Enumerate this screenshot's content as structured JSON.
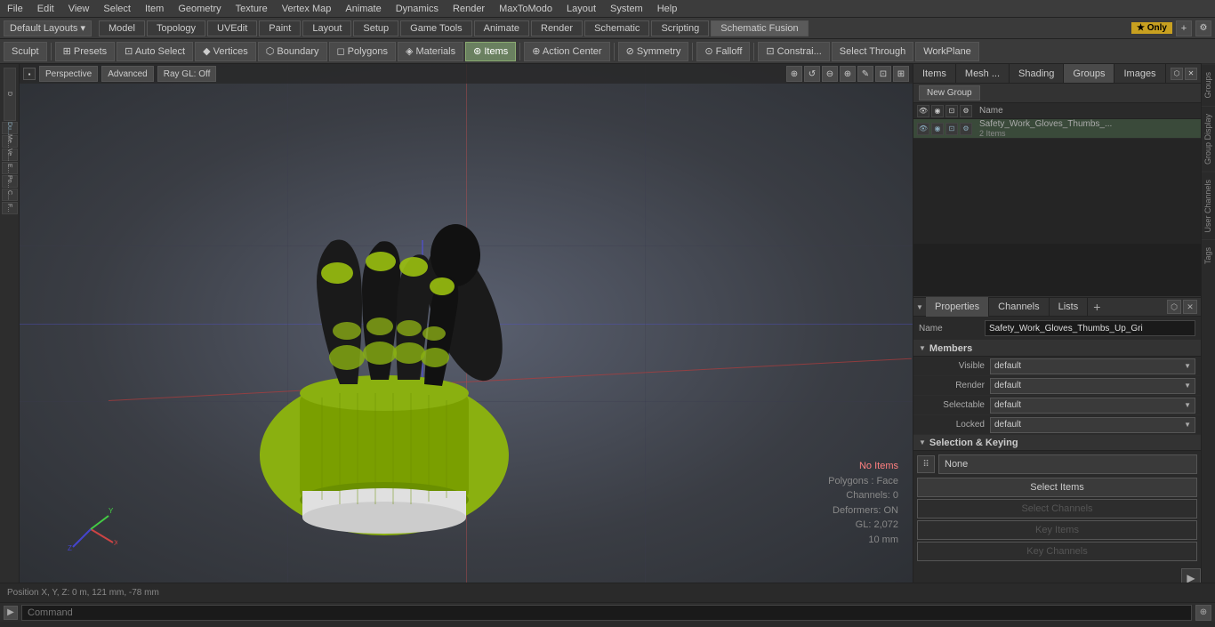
{
  "menubar": {
    "items": [
      "File",
      "Edit",
      "View",
      "Select",
      "Item",
      "Geometry",
      "Texture",
      "Vertex Map",
      "Animate",
      "Dynamics",
      "Render",
      "MaxToModo",
      "Layout",
      "System",
      "Help"
    ]
  },
  "layout_bar": {
    "dropdown": "Default Layouts ▾",
    "tabs": [
      "Model",
      "Topology",
      "UVEdit",
      "Paint",
      "Layout",
      "Setup",
      "Game Tools",
      "Animate",
      "Render",
      "Schematic",
      "Scripting",
      "Schematic Fusion"
    ],
    "active_tab": "Schematic Fusion",
    "star_label": "★ Only",
    "plus_label": "+",
    "gear_label": "⚙"
  },
  "toolbar": {
    "sculpt_label": "Sculpt",
    "presets_label": "⊞ Presets",
    "auto_select_label": "⊡ Auto Select",
    "vertices_label": "◆ Vertices",
    "boundary_label": "⬡ Boundary",
    "polygons_label": "◻ Polygons",
    "materials_label": "◈ Materials",
    "items_label": "⊛ Items",
    "action_center_label": "⊕ Action Center",
    "symmetry_label": "⊘ Symmetry",
    "falloff_label": "⊙ Falloff",
    "constraints_label": "⊡ Constrai...",
    "select_through_label": "Select Through",
    "workplane_label": "WorkPlane"
  },
  "viewport": {
    "perspective_label": "Perspective",
    "advanced_label": "Advanced",
    "ray_gl_label": "Ray GL: Off",
    "view_mode": "Perspective",
    "info": {
      "no_items": "No Items",
      "polygons": "Polygons : Face",
      "channels": "Channels: 0",
      "deformers": "Deformers: ON",
      "gl": "GL: 2,072",
      "scale": "10 mm"
    }
  },
  "groups_panel": {
    "tabs": [
      "Items",
      "Mesh ...",
      "Shading",
      "Groups",
      "Images"
    ],
    "active_tab": "Groups",
    "new_group_btn": "New Group",
    "col_headers": {
      "name_label": "Name"
    },
    "items": [
      {
        "name": "Safety_Work_Gloves_Thumbs_...",
        "count": "2 Items",
        "selected": true
      }
    ]
  },
  "properties_panel": {
    "tabs": [
      "Properties",
      "Channels",
      "Lists"
    ],
    "active_tab": "Properties",
    "name_label": "Name",
    "name_value": "Safety_Work_Gloves_Thumbs_Up_Gri",
    "sections": {
      "members": {
        "title": "Members",
        "visible_label": "Visible",
        "visible_value": "default",
        "render_label": "Render",
        "render_value": "default",
        "selectable_label": "Selectable",
        "selectable_value": "default",
        "locked_label": "Locked",
        "locked_value": "default"
      },
      "selection_keying": {
        "title": "Selection & Keying",
        "none_label": "None",
        "select_items_label": "Select Items",
        "select_channels_label": "Select Channels",
        "key_items_label": "Key Items",
        "key_channels_label": "Key Channels"
      }
    }
  },
  "vertical_tabs": [
    "Groups",
    "Group Display",
    "User Channels",
    "Tags"
  ],
  "bottom_bar": {
    "position": "Position X, Y, Z:  0 m, 121 mm, -78 mm",
    "command_placeholder": "Command",
    "arrow_label": "▶"
  }
}
